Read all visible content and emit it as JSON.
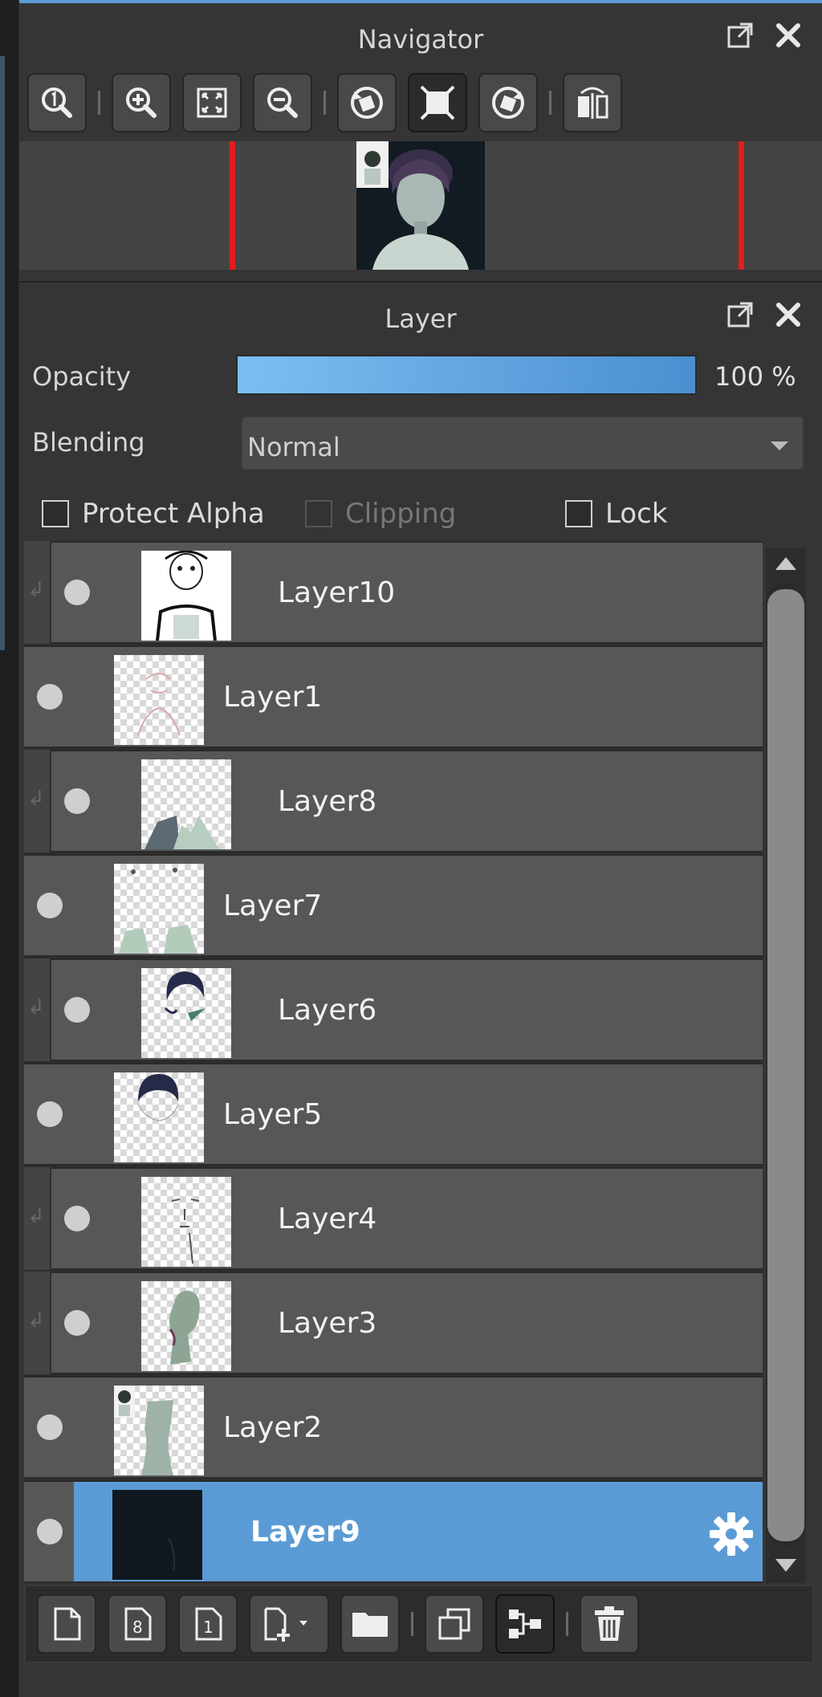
{
  "navigator": {
    "title": "Navigator",
    "tools": [
      {
        "icon": "zoom-actual-icon"
      },
      {
        "icon": "zoom-in-icon"
      },
      {
        "icon": "fit-to-window-icon"
      },
      {
        "icon": "zoom-out-icon"
      },
      {
        "icon": "rotate-left-icon"
      },
      {
        "icon": "reset-rotation-icon"
      },
      {
        "icon": "rotate-right-icon"
      },
      {
        "icon": "flip-horizontal-icon"
      }
    ]
  },
  "layer_panel": {
    "title": "Layer",
    "opacity_label": "Opacity",
    "opacity_value": "100 %",
    "opacity_fraction": 1.0,
    "blending_label": "Blending",
    "blending_value": "Normal",
    "protect_alpha_label": "Protect Alpha",
    "clipping_label": "Clipping",
    "lock_label": "Lock",
    "layers": [
      {
        "name": "Layer10",
        "clipped": true,
        "selected": false
      },
      {
        "name": "Layer1",
        "clipped": false,
        "selected": false
      },
      {
        "name": "Layer8",
        "clipped": true,
        "selected": false
      },
      {
        "name": "Layer7",
        "clipped": false,
        "selected": false
      },
      {
        "name": "Layer6",
        "clipped": true,
        "selected": false
      },
      {
        "name": "Layer5",
        "clipped": false,
        "selected": false
      },
      {
        "name": "Layer4",
        "clipped": true,
        "selected": false
      },
      {
        "name": "Layer3",
        "clipped": true,
        "selected": false
      },
      {
        "name": "Layer2",
        "clipped": false,
        "selected": false
      },
      {
        "name": "Layer9",
        "clipped": false,
        "selected": true
      }
    ]
  },
  "bottom_toolbar": {
    "buttons": [
      {
        "icon": "new-layer-icon"
      },
      {
        "icon": "new-8bit-layer-icon"
      },
      {
        "icon": "new-1bit-layer-icon"
      },
      {
        "icon": "add-layer-menu-icon"
      },
      {
        "icon": "new-folder-icon"
      },
      {
        "icon": "duplicate-layer-icon"
      },
      {
        "icon": "merge-down-icon"
      },
      {
        "icon": "delete-layer-icon"
      }
    ]
  },
  "colors": {
    "accent": "#5b9bd5",
    "panel_bg": "#353535",
    "layer_row_bg": "#575757",
    "nav_marker": "#e21c1c"
  }
}
